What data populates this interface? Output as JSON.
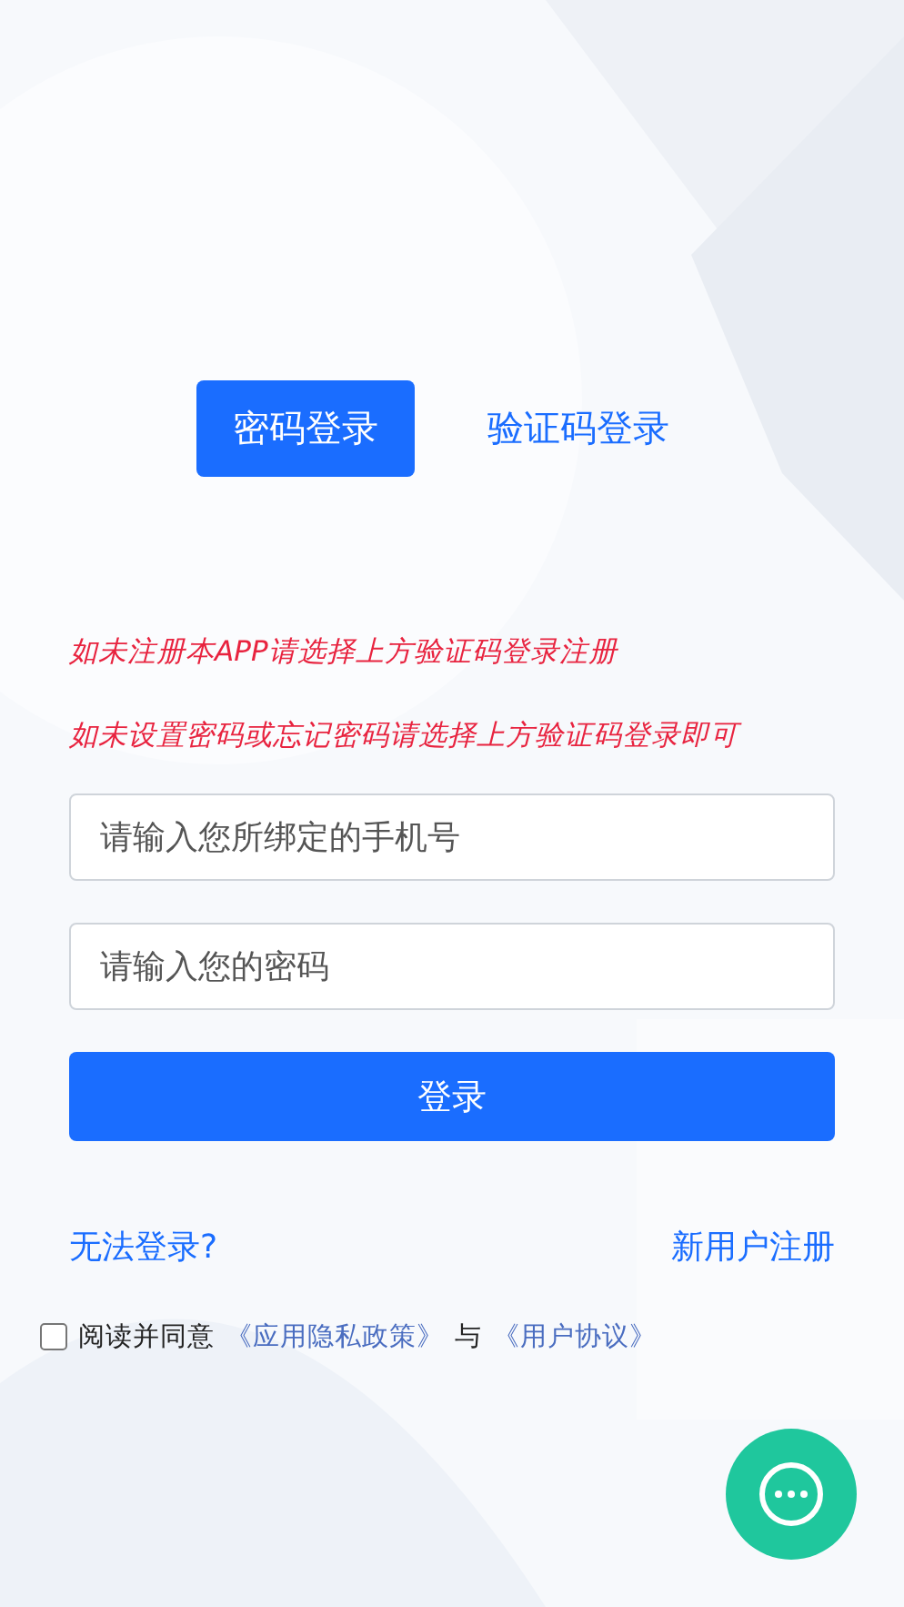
{
  "tabs": [
    {
      "label": "密码登录",
      "selected": true
    },
    {
      "label": "验证码登录",
      "selected": false
    }
  ],
  "notices": [
    "如未注册本APP请选择上方验证码登录注册",
    "如未设置密码或忘记密码请选择上方验证码登录即可"
  ],
  "fields": [
    {
      "placeholder": "请输入您所绑定的手机号"
    },
    {
      "placeholder": "请输入您的密码"
    }
  ],
  "login_button": "登录",
  "links": {
    "left": "无法登录?",
    "right": "新用户注册"
  },
  "agreement": {
    "checked": false,
    "prefix": "阅读并同意",
    "policy": "《应用隐私政策》",
    "joiner": "与",
    "terms": "《用户协议》"
  }
}
